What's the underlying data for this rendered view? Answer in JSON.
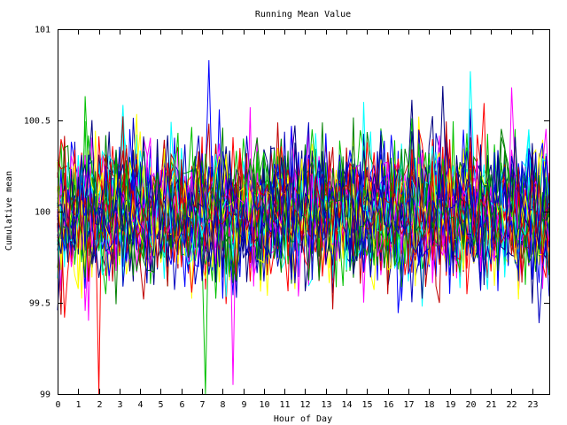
{
  "chart_data": {
    "type": "line",
    "title": "Running Mean Value",
    "xlabel": "Hour of Day",
    "ylabel": "Cumulative mean",
    "xlim": [
      0,
      23.83
    ],
    "ylim": [
      99,
      101
    ],
    "x_ticks": [
      0,
      1,
      2,
      3,
      4,
      5,
      6,
      7,
      8,
      9,
      10,
      11,
      12,
      13,
      14,
      15,
      16,
      17,
      18,
      19,
      20,
      21,
      22,
      23
    ],
    "x_tick_labels": [
      "0",
      "1",
      "2",
      "3",
      "4",
      "5",
      "6",
      "7",
      "8",
      "9",
      "10",
      "11",
      "12",
      "13",
      "14",
      "15",
      "16",
      "17",
      "18",
      "19",
      "20",
      "21",
      "22",
      "23"
    ],
    "y_ticks": [
      99,
      99.5,
      100,
      100.5,
      101
    ],
    "y_tick_labels": [
      "99",
      "99.5",
      "100",
      "100.5",
      "101"
    ],
    "grid": false,
    "legend": "none",
    "series_count": 40,
    "points_per_series": 144,
    "x_step_hours": 0.1667,
    "value_center": 100.0,
    "value_spread_sd": 0.18,
    "notable_extremes": [
      {
        "x": 2.0,
        "y": 99.0
      },
      {
        "x": 7.2,
        "y": 99.0
      },
      {
        "x": 7.3,
        "y": 100.83
      },
      {
        "x": 8.5,
        "y": 99.05
      },
      {
        "x": 20.0,
        "y": 100.77
      }
    ],
    "series_colors": [
      "#ff0000",
      "#00c000",
      "#0000ff",
      "#ff00ff",
      "#00ffff",
      "#ffff00",
      "#000080",
      "#c00000",
      "#008000",
      "#0000c0"
    ]
  }
}
